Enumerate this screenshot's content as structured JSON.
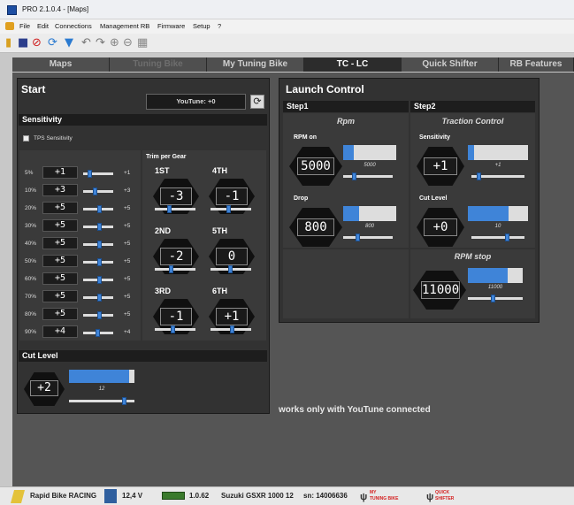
{
  "window": {
    "title": "PRO  2.1.0.4 - [Maps]"
  },
  "menu": [
    "File",
    "Edit",
    "Connections",
    "Management RB",
    "Firmware",
    "Setup",
    "?"
  ],
  "tabs": [
    "Maps",
    "Tuning Bike",
    "My Tuning Bike",
    "TC - LC",
    "Quick Shifter",
    "RB Features"
  ],
  "start": {
    "title": "Start",
    "youtune": "YouTune: +0",
    "sensitivity_header": "Sensitivity",
    "tps_label": "TPS Sensitivity",
    "rows": [
      {
        "pct": "5%",
        "val": "+1",
        "right": "+1"
      },
      {
        "pct": "10%",
        "val": "+3",
        "right": "+3"
      },
      {
        "pct": "20%",
        "val": "+5",
        "right": "+5"
      },
      {
        "pct": "30%",
        "val": "+5",
        "right": "+5"
      },
      {
        "pct": "40%",
        "val": "+5",
        "right": "+5"
      },
      {
        "pct": "50%",
        "val": "+5",
        "right": "+5"
      },
      {
        "pct": "60%",
        "val": "+5",
        "right": "+5"
      },
      {
        "pct": "70%",
        "val": "+5",
        "right": "+5"
      },
      {
        "pct": "80%",
        "val": "+5",
        "right": "+5"
      },
      {
        "pct": "90%",
        "val": "+4",
        "right": "+4"
      }
    ],
    "trim_title": "Trim per Gear",
    "gears": [
      {
        "label": "1ST",
        "val": "-3"
      },
      {
        "label": "4TH",
        "val": "-1"
      },
      {
        "label": "2ND",
        "val": "-2"
      },
      {
        "label": "5TH",
        "val": "0"
      },
      {
        "label": "3RD",
        "val": "-1"
      },
      {
        "label": "6TH",
        "val": "+1"
      }
    ],
    "cut_level_header": "Cut Level",
    "cut_level_val": "+2",
    "cut_level_small": "12"
  },
  "launch": {
    "title": "Launch Control",
    "step1": "Step1",
    "step2": "Step2",
    "rpm_title": "Rpm",
    "rpm_on_label": "RPM on",
    "rpm_on_val": "5000",
    "rpm_on_small": "5000",
    "drop_label": "Drop",
    "drop_val": "800",
    "drop_small": "800",
    "tc_title": "Traction Control",
    "sens_label": "Sensitivity",
    "sens_val": "+1",
    "sens_small": "+1",
    "cut_label": "Cut Level",
    "cut_val": "+0",
    "cut_small": "10",
    "rpm_stop_title": "RPM stop",
    "rpm_stop_val": "11000",
    "rpm_stop_small": "11000"
  },
  "note": "works only with YouTune connected",
  "status": {
    "device": "Rapid Bike RACING",
    "voltage": "12,4 V",
    "fw": "1.0.62",
    "bike": "Suzuki GSXR 1000 12",
    "sn": "sn: 14006636",
    "mtb_line1": "MY",
    "mtb_line2": "TUNING BIKE",
    "qs_line1": "QUICK",
    "qs_line2": "SHIFTER"
  }
}
